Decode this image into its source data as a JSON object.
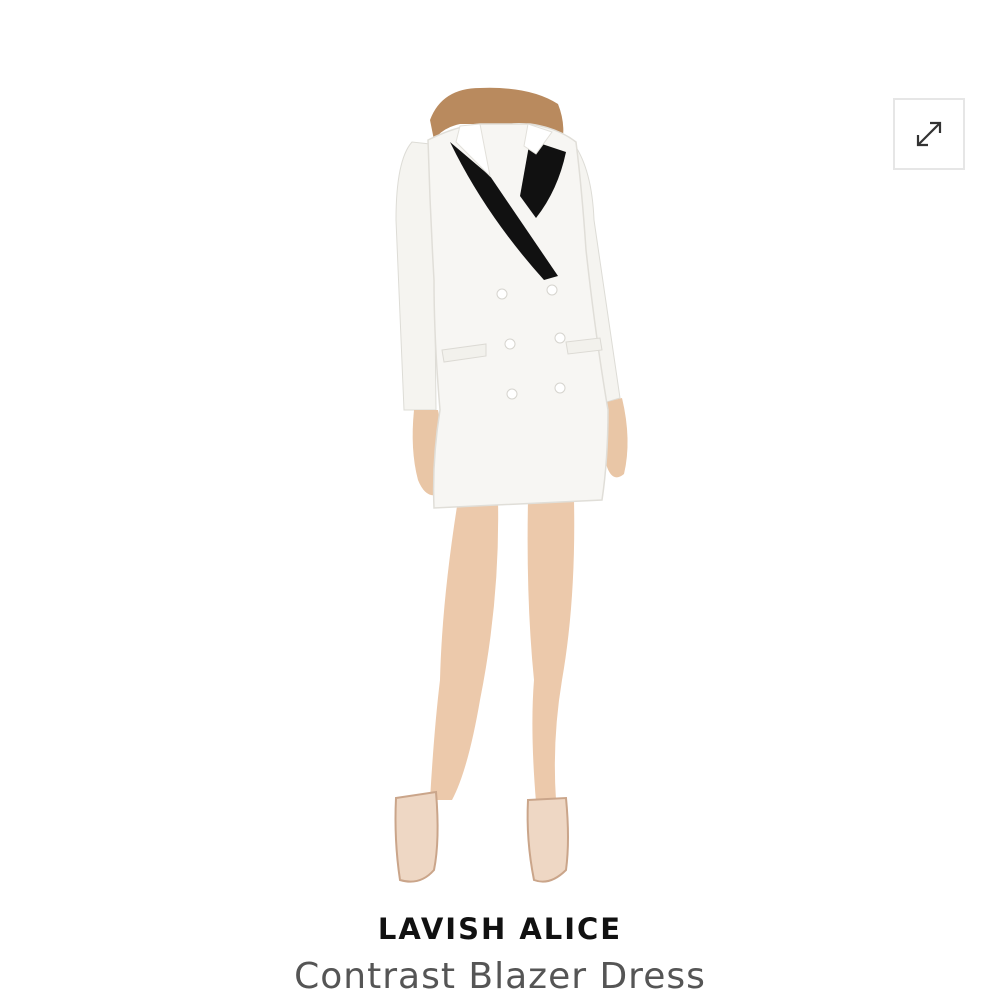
{
  "product": {
    "brand": "LAVISH ALICE",
    "name": "Contrast Blazer Dress",
    "image_alt": "model wearing white double-breasted blazer dress with black lapels"
  },
  "controls": {
    "expand_icon": "expand-arrows-icon"
  },
  "colors": {
    "background": "#ffffff",
    "dress": "#f7f6f3",
    "lapel": "#111111",
    "brand_text": "#111111",
    "name_text": "#555555",
    "button_border": "#e6e6e6"
  }
}
